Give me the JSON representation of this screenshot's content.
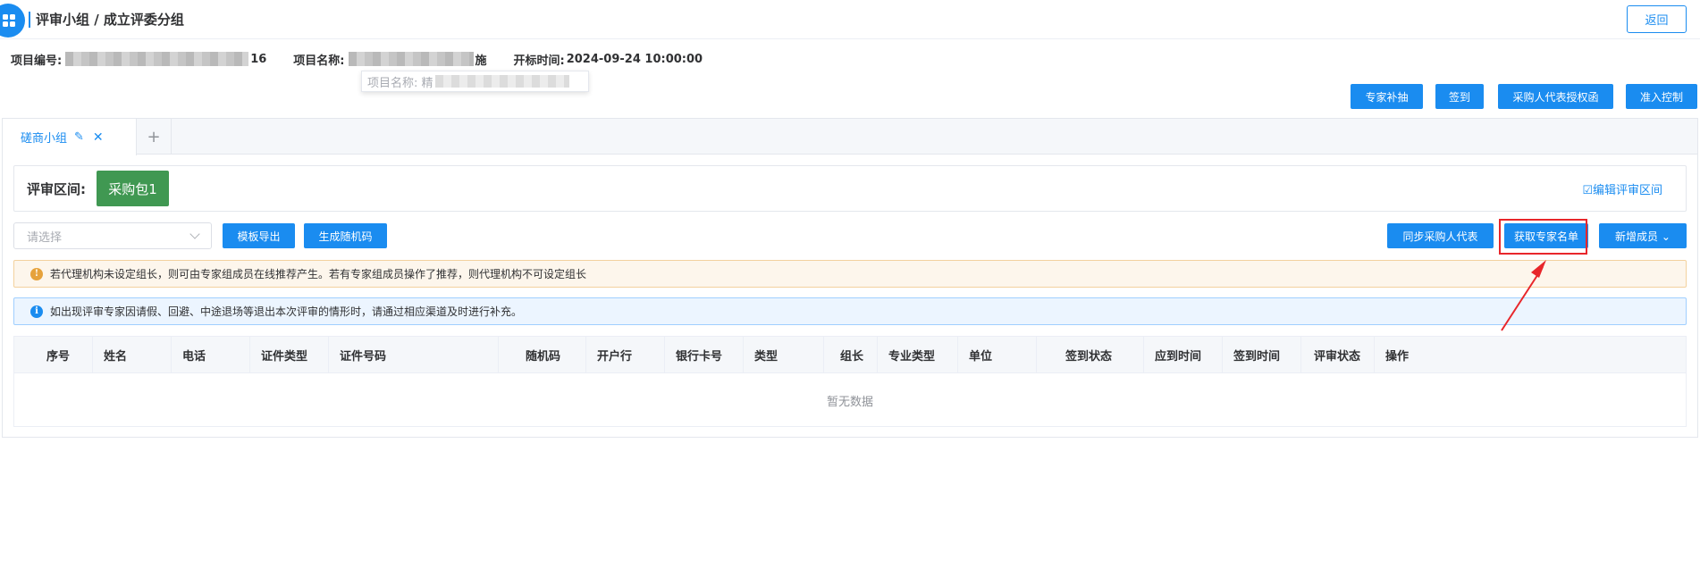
{
  "header": {
    "title": "评审小组 / 成立评委分组",
    "back_label": "返回"
  },
  "info": {
    "project_no_label": "项目编号:",
    "project_no_tail": "16",
    "project_name_label": "项目名称:",
    "project_name_tail": "施",
    "open_time_label": "开标时间:",
    "open_time_value": "2024-09-24 10:00:00",
    "tooltip_prefix": "项目名称: 精"
  },
  "top_actions": {
    "expert_supplement": "专家补抽",
    "sign_in": "签到",
    "purchaser_auth": "采购人代表授权函",
    "access_control": "准入控制"
  },
  "tabs": [
    {
      "label": "磋商小组"
    }
  ],
  "tab_add_label": "+",
  "review_section": {
    "label": "评审区间:",
    "package": "采购包1",
    "edit_label": "编辑评审区间"
  },
  "toolbar": {
    "select_placeholder": "请选择",
    "template_export": "模板导出",
    "generate_code": "生成随机码",
    "sync_purchaser": "同步采购人代表",
    "get_expert_list": "获取专家名单",
    "add_member": "新增成员"
  },
  "alerts": {
    "warning": "若代理机构未设定组长，则可由专家组成员在线推荐产生。若有专家组成员操作了推荐，则代理机构不可设定组长",
    "info": "如出现评审专家因请假、回避、中途退场等退出本次评审的情形时，请通过相应渠道及时进行补充。"
  },
  "table": {
    "columns": [
      "序号",
      "姓名",
      "电话",
      "证件类型",
      "证件号码",
      "随机码",
      "开户行",
      "银行卡号",
      "类型",
      "组长",
      "专业类型",
      "单位",
      "签到状态",
      "应到时间",
      "签到时间",
      "评审状态",
      "操作"
    ],
    "empty_text": "暂无数据"
  },
  "colors": {
    "primary": "#1a8cf0",
    "package_green": "#409852",
    "annotation_red": "#e8262b",
    "warning_bg": "#fdf6ec",
    "info_bg": "#ecf5ff"
  }
}
